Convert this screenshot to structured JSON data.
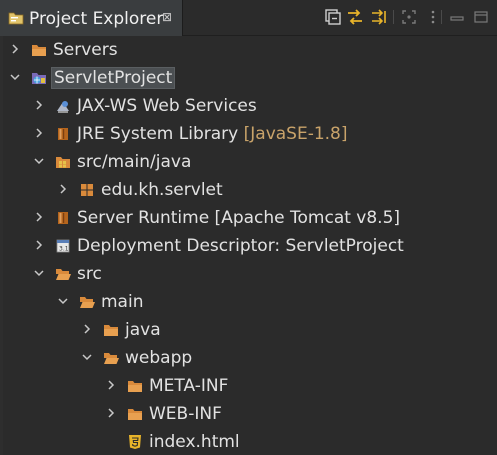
{
  "view": {
    "title": "Project Explorer",
    "close_glyph": "⊠"
  },
  "toolbar": {
    "buttons": [
      "collapse-all-icon",
      "link-with-editor-icon",
      "sync-icon",
      "focus-icon",
      "view-menu-icon",
      "minimize-icon",
      "maximize-icon"
    ]
  },
  "tree": {
    "items": [
      {
        "label": "Servers",
        "deco": ""
      },
      {
        "label": "ServletProject",
        "deco": ""
      },
      {
        "label": "JAX-WS Web Services",
        "deco": ""
      },
      {
        "label": "JRE System Library ",
        "deco": "[JavaSE-1.8]"
      },
      {
        "label": "src/main/java",
        "deco": ""
      },
      {
        "label": "edu.kh.servlet",
        "deco": ""
      },
      {
        "label": "Server Runtime [Apache Tomcat v8.5]",
        "deco": ""
      },
      {
        "label": "Deployment Descriptor: ServletProject",
        "deco": ""
      },
      {
        "label": "src",
        "deco": ""
      },
      {
        "label": "main",
        "deco": ""
      },
      {
        "label": "java",
        "deco": ""
      },
      {
        "label": "webapp",
        "deco": ""
      },
      {
        "label": "META-INF",
        "deco": ""
      },
      {
        "label": "WEB-INF",
        "deco": ""
      },
      {
        "label": "index.html",
        "deco": ""
      }
    ]
  },
  "colors": {
    "background": "#2b2b2b",
    "text": "#e2e2e2",
    "decoration": "#c9a36a",
    "folder": "#d98a3b",
    "selection": "#4b4f52"
  }
}
